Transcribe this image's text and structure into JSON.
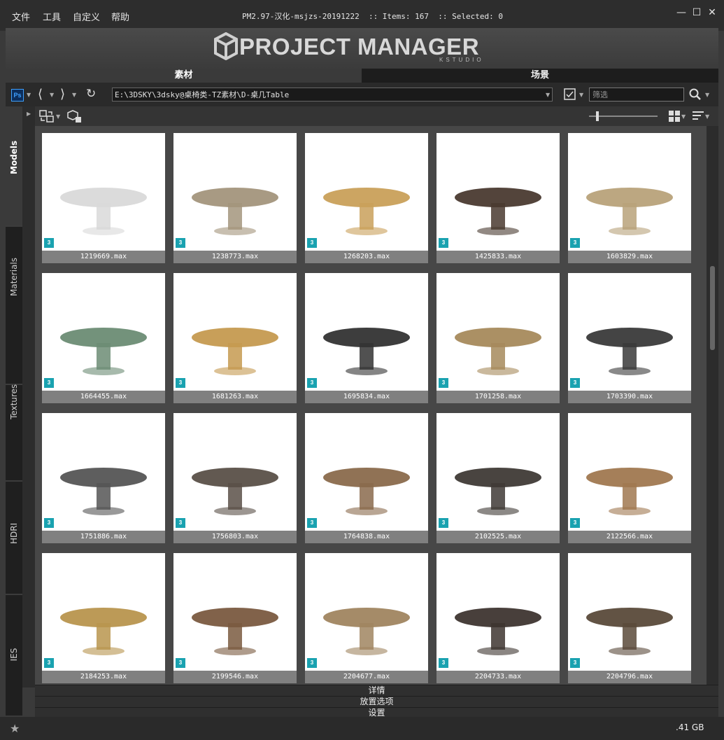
{
  "menu": [
    "文件",
    "工具",
    "自定义",
    "帮助"
  ],
  "window_title": "PM2.97-汉化-msjzs-20191222  :: Items: 167  :: Selected: 0",
  "window_controls": {
    "min": "—",
    "max": "☐",
    "close": "✕"
  },
  "banner": {
    "title": "PROJECT MANAGER",
    "subtitle": "KSTUDIO"
  },
  "tabs": [
    {
      "label": "素材"
    },
    {
      "label": "场景"
    }
  ],
  "toolbar": {
    "ps_label": "Ps",
    "path": "E:\\3DSKY\\3dsky@桌椅类-TZ素材\\D-桌几Table",
    "filter_placeholder": "筛选"
  },
  "sidebar": [
    "Models",
    "Materials",
    "Textures",
    "HDRI",
    "IES"
  ],
  "items": [
    {
      "name": "1219669.max",
      "tone": "#d9d9d9"
    },
    {
      "name": "1238773.max",
      "tone": "#a3957c"
    },
    {
      "name": "1268203.max",
      "tone": "#c9a05a"
    },
    {
      "name": "1425833.max",
      "tone": "#4a3a30"
    },
    {
      "name": "1603829.max",
      "tone": "#b8a27a"
    },
    {
      "name": "1664455.max",
      "tone": "#6c8c74"
    },
    {
      "name": "1681263.max",
      "tone": "#c59a50"
    },
    {
      "name": "1695834.max",
      "tone": "#333333"
    },
    {
      "name": "1701258.max",
      "tone": "#a68a5c"
    },
    {
      "name": "1703390.max",
      "tone": "#3a3a3a"
    },
    {
      "name": "1751886.max",
      "tone": "#555555"
    },
    {
      "name": "1756803.max",
      "tone": "#5a5048"
    },
    {
      "name": "1764838.max",
      "tone": "#8a6a4c"
    },
    {
      "name": "2102525.max",
      "tone": "#3f3a36"
    },
    {
      "name": "2122566.max",
      "tone": "#a07850"
    },
    {
      "name": "2184253.max",
      "tone": "#b8954e"
    },
    {
      "name": "2199546.max",
      "tone": "#7a5a40"
    },
    {
      "name": "2204677.max",
      "tone": "#a08560"
    },
    {
      "name": "2204733.max",
      "tone": "#3e3530"
    },
    {
      "name": "2204796.max",
      "tone": "#5a4a3a"
    }
  ],
  "panels": [
    "详情",
    "放置选项",
    "设置"
  ],
  "status": {
    "size": ".41 GB"
  }
}
